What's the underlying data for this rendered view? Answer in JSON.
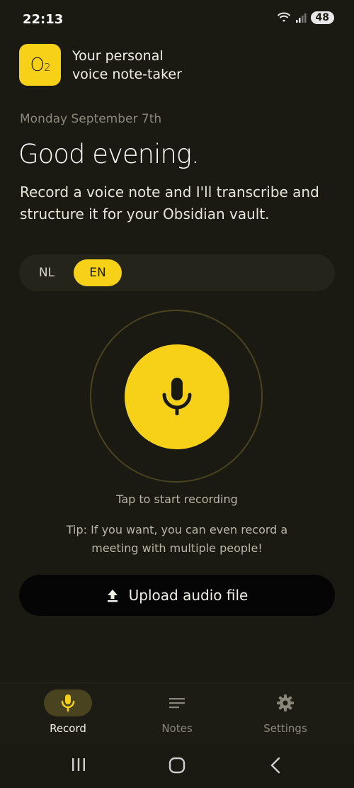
{
  "status_bar": {
    "time": "22:13",
    "battery": "48"
  },
  "header": {
    "logo_main": "O",
    "logo_sub": "2",
    "tagline_line1": "Your personal",
    "tagline_line2": "voice note-taker"
  },
  "date": "Monday September 7th",
  "greeting": "Good evening.",
  "intro": "Record a voice note and I'll transcribe and structure it for your Obsidian vault.",
  "language_toggle": {
    "options": [
      "NL",
      "EN"
    ],
    "selected": "EN"
  },
  "record": {
    "hint": "Tap to start recording",
    "tip": "Tip: If you want, you can even record a meeting with multiple people!"
  },
  "upload": {
    "label": "Upload audio file"
  },
  "bottom_nav": {
    "items": [
      {
        "label": "Record",
        "icon": "mic-icon",
        "active": true
      },
      {
        "label": "Notes",
        "icon": "notes-icon",
        "active": false
      },
      {
        "label": "Settings",
        "icon": "gear-icon",
        "active": false
      }
    ]
  },
  "colors": {
    "accent": "#f7d117",
    "background": "#1b1a12",
    "muted": "#8a877a"
  }
}
